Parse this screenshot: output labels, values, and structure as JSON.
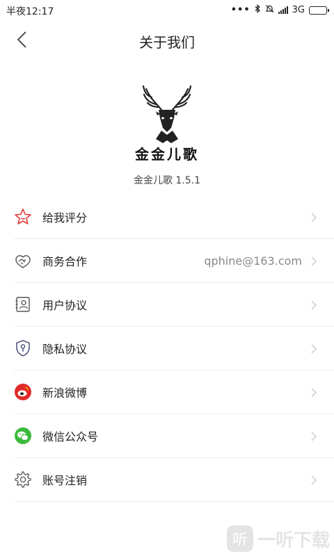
{
  "status_bar": {
    "time": "半夜12:17",
    "dots": "•••",
    "network": "3G"
  },
  "header": {
    "title": "关于我们"
  },
  "app": {
    "logo_text": "金金儿歌",
    "version_text": "金金儿歌  1.5.1"
  },
  "menu": {
    "items": [
      {
        "label": "给我评分",
        "value": "",
        "icon": "star-icon"
      },
      {
        "label": "商务合作",
        "value": "qphine@163.com",
        "icon": "handshake-icon"
      },
      {
        "label": "用户协议",
        "value": "",
        "icon": "user-agreement-icon"
      },
      {
        "label": "隐私协议",
        "value": "",
        "icon": "privacy-shield-icon"
      },
      {
        "label": "新浪微博",
        "value": "",
        "icon": "weibo-icon"
      },
      {
        "label": "微信公众号",
        "value": "",
        "icon": "wechat-icon"
      },
      {
        "label": "账号注销",
        "value": "",
        "icon": "gear-icon"
      }
    ]
  },
  "watermark": {
    "badge": "听",
    "text": "一听下载"
  },
  "colors": {
    "star": "#e63b3b",
    "weibo": "#e02a2a",
    "wechat": "#3cb93c",
    "icon_gray": "#555555",
    "divider": "#ececec"
  }
}
